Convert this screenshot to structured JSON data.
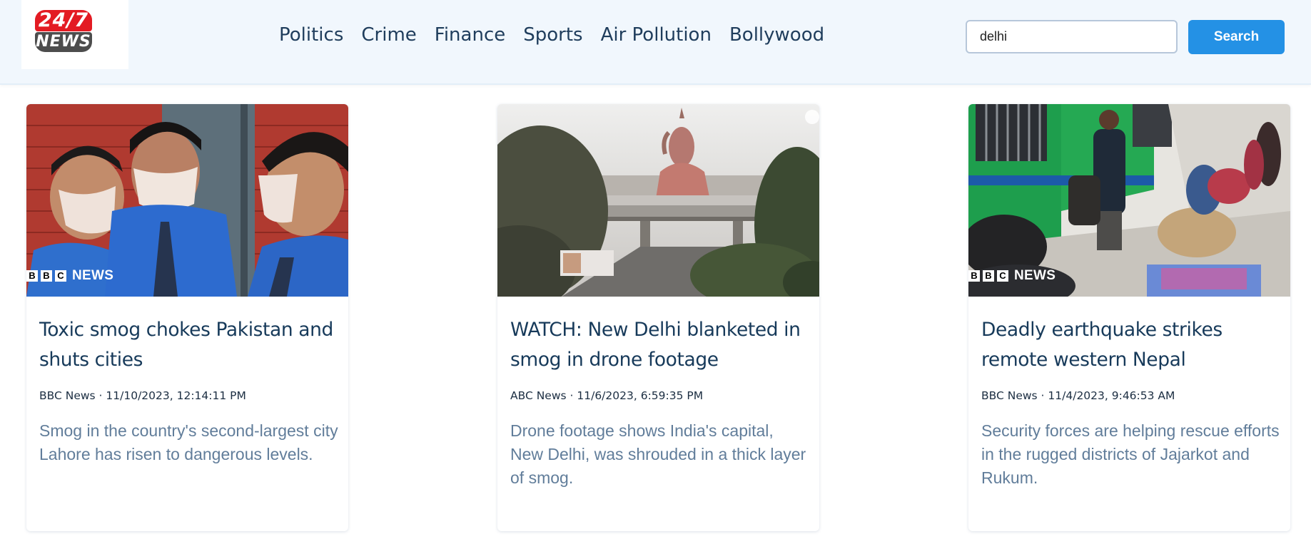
{
  "logo": {
    "top_text": "24/7",
    "bottom_text": "NEWS"
  },
  "nav": {
    "items": [
      "Politics",
      "Crime",
      "Finance",
      "Sports",
      "Air Pollution",
      "Bollywood"
    ]
  },
  "search": {
    "value": "delhi",
    "button_label": "Search"
  },
  "colors": {
    "accent": "#2491e5",
    "title": "#173a5a",
    "description": "#617d9a",
    "header_bg": "#f1f7fd"
  },
  "articles": [
    {
      "title": "Toxic smog chokes Pakistan and shuts cities",
      "meta": "BBC News · 11/10/2023, 12:14:11 PM",
      "description": "Smog in the country's second-largest city Lahore has risen to dangerous levels.",
      "watermark": "BBC NEWS"
    },
    {
      "title": "WATCH: New Delhi blanketed in smog in drone footage",
      "meta": "ABC News · 11/6/2023, 6:59:35 PM",
      "description": "Drone footage shows India's capital, New Delhi, was shrouded in a thick layer of smog."
    },
    {
      "title": "Deadly earthquake strikes remote western Nepal",
      "meta": "BBC News · 11/4/2023, 9:46:53 AM",
      "description": "Security forces are helping rescue efforts in the rugged districts of Jajarkot and Rukum.",
      "watermark": "BBC NEWS"
    }
  ]
}
